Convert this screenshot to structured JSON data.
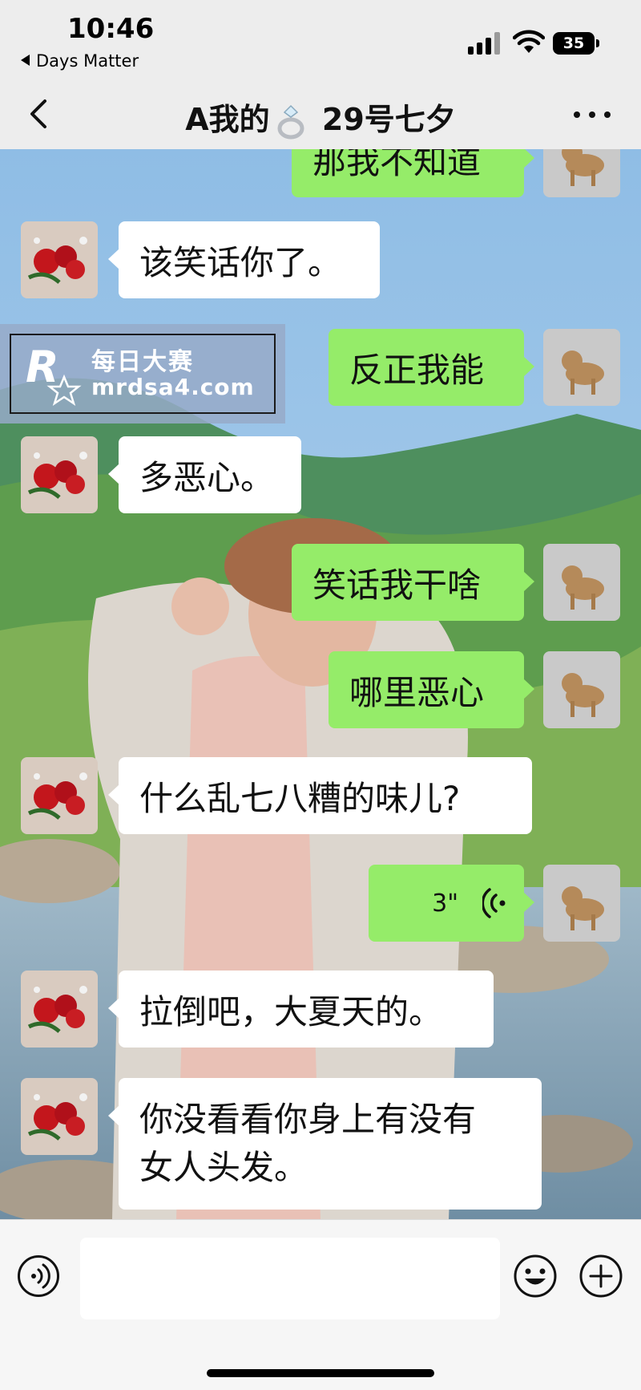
{
  "status_bar": {
    "time": "10:46",
    "back_app": "Days Matter",
    "battery": "35"
  },
  "nav": {
    "title_prefix": "A我的",
    "title_suffix": "29号七夕"
  },
  "watermark": {
    "line1": "每日大赛",
    "line2": "mrdsa4.com"
  },
  "messages": [
    {
      "side": "right",
      "text": "那我不知道"
    },
    {
      "side": "left",
      "text": "该笑话你了。"
    },
    {
      "side": "right",
      "text": "反正我能"
    },
    {
      "side": "left",
      "text": "多恶心。"
    },
    {
      "side": "right",
      "text": "笑话我干啥"
    },
    {
      "side": "right",
      "text": "哪里恶心"
    },
    {
      "side": "left",
      "text": "什么乱七八糟的味儿?"
    },
    {
      "side": "right",
      "type": "voice",
      "text": "3\""
    },
    {
      "side": "left",
      "text": "拉倒吧，大夏天的。"
    },
    {
      "side": "left",
      "lines": [
        "你没看看你身上有没有",
        "女人头发。"
      ]
    }
  ],
  "input": {
    "value": "",
    "placeholder": ""
  },
  "colors": {
    "sent_bubble": "#95ec69",
    "received_bubble": "#ffffff",
    "header_bg": "#ededed"
  },
  "icons": {
    "voice_mode": "voice-wave-icon",
    "emoji": "smiley-face-icon",
    "more": "plus-icon",
    "back": "chevron-left-icon"
  }
}
